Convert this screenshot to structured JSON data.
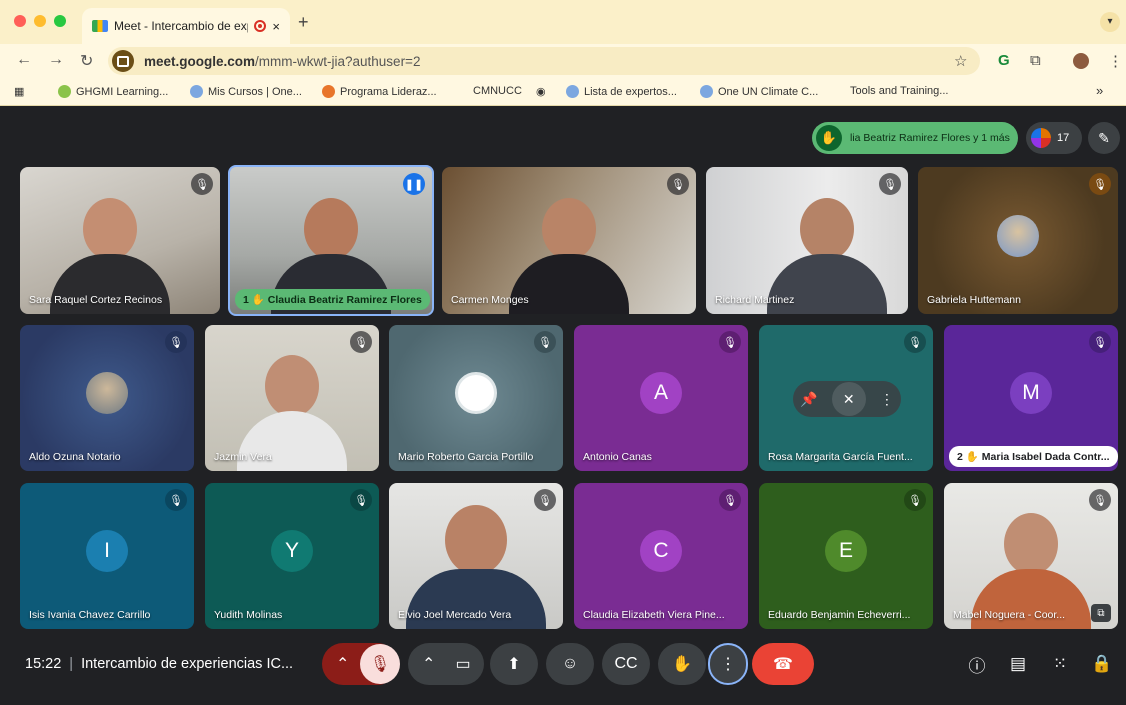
{
  "browser": {
    "tab_title": "Meet - Intercambio de exp",
    "tab_close": "×",
    "new_tab": "+",
    "url_domain": "meet.google.com",
    "url_path": "/mmm-wkwt-jia?authuser=2",
    "bookmarks": [
      {
        "label": "GHGMI Learning...",
        "icon_color": "#8bc34a"
      },
      {
        "label": "Mis Cursos | One...",
        "icon_color": "#7ca7e0"
      },
      {
        "label": "Programa Lideraz...",
        "icon_color": "#e8752a"
      },
      {
        "label": "CMNUCC",
        "icon_color": ""
      },
      {
        "label": "Lista de expertos...",
        "icon_color": "#7ca7e0"
      },
      {
        "label": "One UN Climate C...",
        "icon_color": "#7ca7e0"
      },
      {
        "label": "Tools and Training...",
        "icon_color": ""
      }
    ],
    "more_bookmarks": "»"
  },
  "meet": {
    "raised_hand_banner": "lia Beatriz Ramirez Flores y 1 más",
    "participant_count": "17",
    "tiles": [
      {
        "name": "Sara Raquel Cortez Recinos",
        "type": "video",
        "mic": "muted"
      },
      {
        "name": "Claudia Beatriz Ramirez Flores",
        "prefix": "1",
        "type": "video",
        "mic": "speaking",
        "pill": "green"
      },
      {
        "name": "Carmen Monges",
        "type": "video",
        "mic": "muted"
      },
      {
        "name": "Richard Martinez",
        "type": "video",
        "mic": "muted"
      },
      {
        "name": "Gabriela Huttemann",
        "type": "avatar",
        "mic": "muted"
      },
      {
        "name": "Aldo Ozuna Notario",
        "type": "avatar",
        "mic": "muted"
      },
      {
        "name": "Jazmin Vera",
        "type": "video",
        "mic": "muted"
      },
      {
        "name": "Mario Roberto Garcia Portillo",
        "type": "avatar",
        "mic": "muted"
      },
      {
        "name": "Antonio Canas",
        "type": "letter",
        "letter": "A",
        "mic": "muted"
      },
      {
        "name": "Rosa Margarita García Fuent...",
        "type": "letter",
        "mic": "muted"
      },
      {
        "name": "Maria Isabel Dada Contr...",
        "prefix": "2",
        "type": "letter",
        "letter": "M",
        "mic": "muted",
        "pill": "white"
      },
      {
        "name": "Isis Ivania Chavez Carrillo",
        "type": "letter",
        "letter": "I",
        "mic": "muted"
      },
      {
        "name": "Yudith Molinas",
        "type": "letter",
        "letter": "Y",
        "mic": "muted"
      },
      {
        "name": "Elvio Joel Mercado Vera",
        "type": "video",
        "mic": "muted"
      },
      {
        "name": "Claudia Elizabeth Viera Pine...",
        "type": "letter",
        "letter": "C",
        "mic": "muted"
      },
      {
        "name": "Eduardo Benjamin Echeverri...",
        "type": "letter",
        "letter": "E",
        "mic": "muted"
      },
      {
        "name": "Mabel Noguera - Coor...",
        "type": "video",
        "mic": "muted"
      }
    ],
    "meeting_time": "15:22",
    "meeting_title": "Intercambio de experiencias IC..."
  }
}
